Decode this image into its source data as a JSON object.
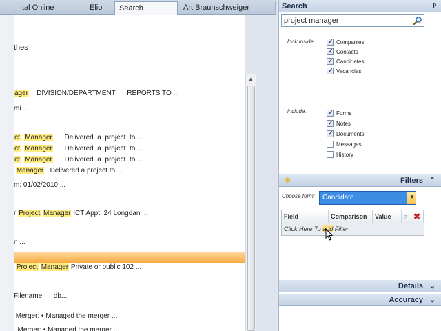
{
  "tabs": [
    {
      "label": "tal Online",
      "active": false
    },
    {
      "label": "Elio Rossi",
      "active": false
    },
    {
      "label": "Search results",
      "active": true,
      "close": "×"
    },
    {
      "label": "Art Braunschweiger",
      "active": false
    }
  ],
  "results": {
    "lines": [
      {
        "segments": [
          {
            "t": "thes"
          }
        ]
      },
      {
        "segments": [
          {
            "t": "ager",
            "hl": true
          },
          {
            "t": "    DIVISION/DEPARTMENT      REPORTS TO ..."
          }
        ]
      },
      {
        "segments": [
          {
            "t": "mi ..."
          }
        ]
      },
      {
        "segments": [
          {
            "t": "ct",
            "hl": true
          },
          {
            "t": "  "
          },
          {
            "t": "Manager",
            "hl": true
          },
          {
            "t": "      Delivered  a  project  to ..."
          }
        ]
      },
      {
        "segments": [
          {
            "t": "ct",
            "hl": true
          },
          {
            "t": "  "
          },
          {
            "t": "Manager",
            "hl": true
          },
          {
            "t": "      Delivered  a  project  to ..."
          }
        ]
      },
      {
        "segments": [
          {
            "t": "ct",
            "hl": true
          },
          {
            "t": "  "
          },
          {
            "t": "Manager",
            "hl": true
          },
          {
            "t": "      Delivered  a  project  to ..."
          }
        ]
      },
      {
        "segments": [
          {
            "t": " "
          },
          {
            "t": "Manager",
            "hl": true
          },
          {
            "t": "   Delivered a project to ..."
          }
        ]
      },
      {
        "segments": [
          {
            "t": "m: 01/02/2010 ..."
          }
        ]
      },
      {
        "segments": [
          {
            "t": "r "
          },
          {
            "t": "Project",
            "hl": true
          },
          {
            "t": " "
          },
          {
            "t": "Manager",
            "hl": true
          },
          {
            "t": " ICT Appt. 24 Longdan ..."
          }
        ]
      },
      {
        "segments": [
          {
            "t": "n ..."
          }
        ]
      },
      {
        "segments": [
          {
            "t": " "
          },
          {
            "t": "Project",
            "hl": true
          },
          {
            "t": " "
          },
          {
            "t": "Manager",
            "hl": true
          },
          {
            "t": " Private or public 102 ..."
          }
        ]
      },
      {
        "segments": [
          {
            "t": "Filename:     db..."
          }
        ]
      },
      {
        "segments": [
          {
            "t": " Merger: • Managed the merger ..."
          }
        ]
      },
      {
        "segments": [
          {
            "t": "  Merger: • Managed the merger ..."
          }
        ]
      }
    ]
  },
  "search": {
    "title": "Search",
    "pin": "ᵖ",
    "query": "project manager",
    "look_inside_label": "look inside..",
    "look_inside": [
      {
        "label": "Companies",
        "checked": true
      },
      {
        "label": "Contacts",
        "checked": true
      },
      {
        "label": "Candidates",
        "checked": true
      },
      {
        "label": "Vacancies",
        "checked": true
      }
    ],
    "include_label": "include..",
    "include": [
      {
        "label": "Forms",
        "checked": true
      },
      {
        "label": "Notes",
        "checked": true
      },
      {
        "label": "Documents",
        "checked": true
      },
      {
        "label": "Messages",
        "checked": false
      },
      {
        "label": "History",
        "checked": false
      }
    ]
  },
  "filters": {
    "title": "Filters",
    "collapse": "⌃",
    "choose_form_label": "Choose form:",
    "form_value": "Candidate",
    "columns": [
      "Field",
      "Comparison",
      "Value"
    ],
    "add_row_text_pre": "Click Here To ",
    "add_row_text_hl": "add",
    "add_row_text_post": " Filter"
  },
  "details": {
    "title": "Details",
    "expand": "⌄"
  },
  "accuracy": {
    "title": "Accuracy",
    "expand": "⌄"
  },
  "colors": {
    "accent": "#3e8de4",
    "highlight": "#ffec80",
    "selection": "#f8a93b"
  }
}
